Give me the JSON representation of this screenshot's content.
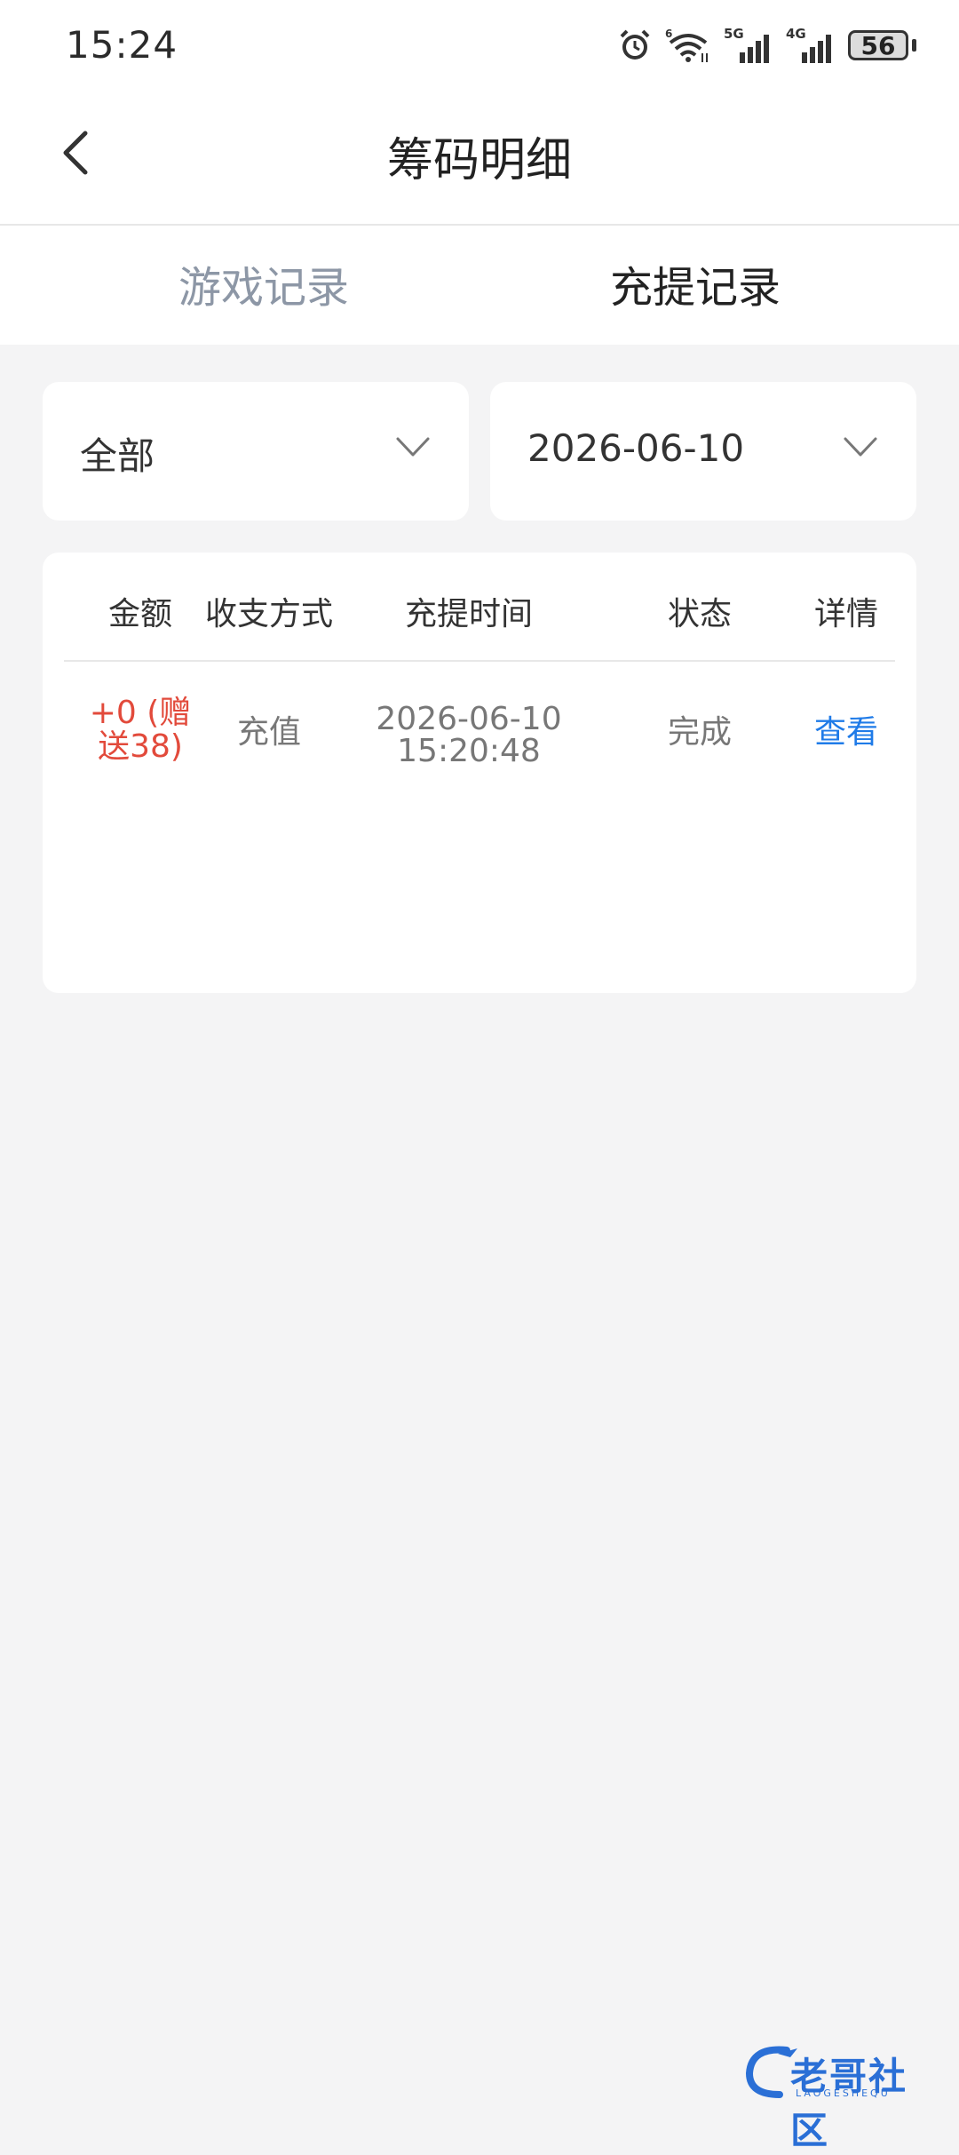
{
  "status_bar": {
    "time": "15:24",
    "battery": "56",
    "icons": [
      "alarm-icon",
      "wifi-icon",
      "signal-5g-icon",
      "signal-4g-icon",
      "battery-icon"
    ]
  },
  "navbar": {
    "title": "筹码明细"
  },
  "tabs": [
    {
      "label": "游戏记录",
      "active": false
    },
    {
      "label": "充提记录",
      "active": true
    }
  ],
  "filters": {
    "type": "全部",
    "date": "2026-06-10"
  },
  "table": {
    "columns": [
      "金额",
      "收支方式",
      "充提时间",
      "状态",
      "详情"
    ],
    "rows": [
      {
        "amount_line1": "+0 (赠",
        "amount_line2": "送38)",
        "method": "充值",
        "date": "2026-06-10",
        "time": "15:20:48",
        "status": "完成",
        "detail": "查看"
      }
    ]
  },
  "watermark": {
    "text": "老哥社区",
    "subtext": "LAOGESHEQU"
  },
  "colors": {
    "accent_blue": "#1f7be8",
    "amount_red": "#e24a3b",
    "tab_inactive": "#8d97a6",
    "background": "#f4f4f5"
  }
}
